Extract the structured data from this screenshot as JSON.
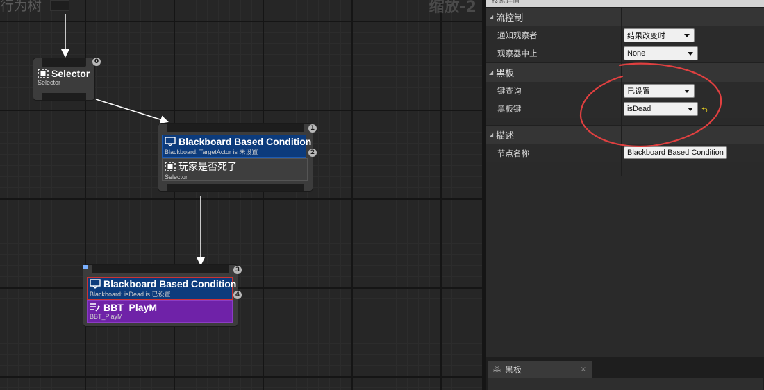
{
  "graph": {
    "title": "行为树",
    "zoom": "缩放-2",
    "nodes": {
      "root_selector": {
        "title": "Selector",
        "subtitle": "Selector",
        "index": "0"
      },
      "dead_selector": {
        "index_top": "1",
        "decorator": {
          "title": "Blackboard Based Condition",
          "subtitle": "Blackboard: TargetActor is 未设置",
          "index": "2"
        },
        "title": "玩家是否死了",
        "subtitle": "Selector"
      },
      "play_task": {
        "index_top": "3",
        "decorator": {
          "title": "Blackboard Based Condition",
          "subtitle": "Blackboard: isDead is 已设置",
          "index": "4"
        },
        "title": "BBT_PlayM",
        "subtitle": "BBT_PlayM"
      }
    }
  },
  "details": {
    "header": "搜索详情",
    "categories": {
      "flow": {
        "label": "流控制",
        "rows": [
          {
            "label": "通知观察者",
            "value": "结果改变时"
          },
          {
            "label": "观察器中止",
            "value": "None"
          }
        ]
      },
      "blackboard": {
        "label": "黑板",
        "rows": [
          {
            "label": "键查询",
            "value": "已设置"
          },
          {
            "label": "黑板键",
            "value": "isDead"
          }
        ]
      },
      "description": {
        "label": "描述",
        "rows": [
          {
            "label": "节点名称",
            "value": "Blackboard Based Condition"
          }
        ]
      }
    },
    "reset_icon": "reset-arrow-icon"
  },
  "bottom_tab": {
    "label": "黑板",
    "close": "×",
    "icon": "blackboard-icon"
  },
  "colors": {
    "decorator": "#0c3b7c",
    "task": "#6f22a8",
    "annotation": "#e04040",
    "wire": "#ffffff"
  }
}
